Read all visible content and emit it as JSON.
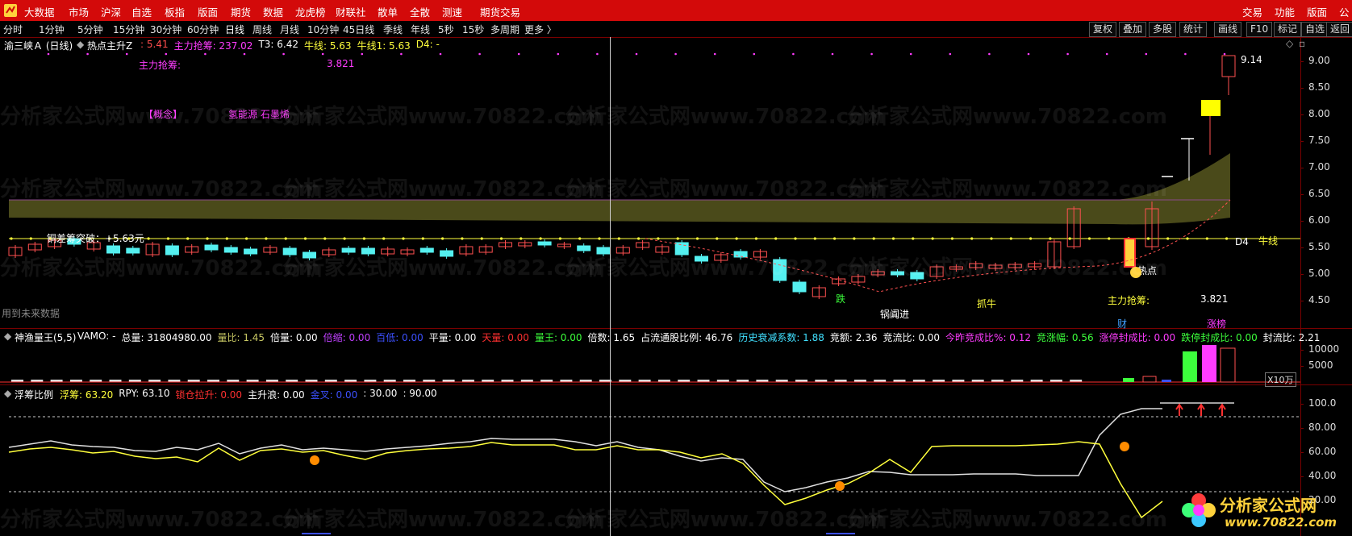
{
  "menubar": {
    "left_items": [
      "大数据",
      "市场",
      "沪深",
      "自选",
      "板指",
      "版面",
      "期货",
      "数据",
      "龙虎榜",
      "财联社",
      "散单",
      "全散",
      "测速",
      "期货交易"
    ],
    "right_items": [
      "交易",
      "功能",
      "版面",
      "公"
    ]
  },
  "periodbar": {
    "periods": [
      "分时",
      "1分钟",
      "5分钟",
      "15分钟",
      "30分钟",
      "60分钟",
      "日线",
      "周线",
      "月线",
      "10分钟",
      "45日线",
      "季线",
      "年线",
      "5秒",
      "15秒",
      "多周期",
      "更多 〉"
    ],
    "right_buttons": [
      "复权",
      "叠加",
      "多股",
      "统计",
      "画线",
      "F10",
      "标记",
      "自选",
      "返回"
    ]
  },
  "main_panel": {
    "stock_title": "渝三峡Ａ (日线)",
    "indicator_name": "热点主升Z",
    "values": [
      {
        "text": ": 5.41",
        "color": "#ff4d4d"
      },
      {
        "text": "主力抢筹: 237.02",
        "color": "#ff3cff"
      },
      {
        "text": "T3: 6.42",
        "color": "#ffffff"
      },
      {
        "text": "牛线: 5.63",
        "color": "#ffff3c"
      },
      {
        "text": "牛线1: 5.63",
        "color": "#ffff3c"
      },
      {
        "text": "D4: -",
        "color": "#ffff3c"
      }
    ],
    "annot_zhuli_label": "主力抢筹:",
    "annot_zhuli_value": "3.821",
    "concept_label": "【概念】",
    "concept_value": "氢能源 石墨烯",
    "breakout_label": "铜差筹突破：+5.63元",
    "future_data": "用到未来数据",
    "label_die": "跌",
    "label_zhua_niu": "抓牛",
    "label_wo_lun": "锅阗进",
    "label_re_dian": "热点",
    "label_niu_xian": "牛线",
    "label_d4": "D4",
    "label_zhuli_bottom": "主力抢筹:",
    "label_zhuli_bottom_val": "3.821",
    "label_cai": "财",
    "label_zhang_bang": "涨榜",
    "high_price_label": "9.14",
    "y_axis": [
      "9.00",
      "8.50",
      "8.00",
      "7.50",
      "7.00",
      "6.50",
      "6.00",
      "5.50",
      "5.00",
      "4.50"
    ]
  },
  "vol_panel": {
    "title": "神渔量王(5,5)",
    "values": [
      {
        "text": "VAMO: -",
        "color": "#ffffff"
      },
      {
        "text": "总量: 31804980.00",
        "color": "#ffffff"
      },
      {
        "text": "量比: 1.45",
        "color": "#c8c864"
      },
      {
        "text": "倍量: 0.00",
        "color": "#ffffff"
      },
      {
        "text": "倍缩: 0.00",
        "color": "#c040ff"
      },
      {
        "text": "百低: 0.00",
        "color": "#3c50ff"
      },
      {
        "text": "平量: 0.00",
        "color": "#ffffff"
      },
      {
        "text": "天量: 0.00",
        "color": "#ff3030"
      },
      {
        "text": "量王: 0.00",
        "color": "#3cff3c"
      },
      {
        "text": "倍数: 1.65",
        "color": "#ffffff"
      },
      {
        "text": "占流通股比例: 46.76",
        "color": "#ffffff"
      },
      {
        "text": "历史衰减系数: 1.88",
        "color": "#40e0ff"
      },
      {
        "text": "竞额: 2.36",
        "color": "#ffffff"
      },
      {
        "text": "竞流比: 0.00",
        "color": "#ffffff"
      },
      {
        "text": "今昨竞成比%: 0.12",
        "color": "#ff3cff"
      },
      {
        "text": "竞涨幅: 0.56",
        "color": "#3cff3c"
      },
      {
        "text": "涨停封成比: 0.00",
        "color": "#ff3cff"
      },
      {
        "text": "跌停封成比: 0.00",
        "color": "#3cff3c"
      },
      {
        "text": "封流比: 2.21",
        "color": "#ffffff"
      }
    ],
    "y_axis": [
      "10000",
      "5000"
    ],
    "unit": "X10万"
  },
  "ratio_panel": {
    "title": "浮筹比例",
    "values": [
      {
        "text": "浮筹: 63.20",
        "color": "#ffff3c"
      },
      {
        "text": "RPY: 63.10",
        "color": "#ffffff"
      },
      {
        "text": "锁仓拉升: 0.00",
        "color": "#ff3030"
      },
      {
        "text": "主升浪: 0.00",
        "color": "#ffffff"
      },
      {
        "text": "金叉: 0.00",
        "color": "#3c50ff"
      },
      {
        "text": ": 30.00",
        "color": "#ffffff"
      },
      {
        "text": ": 90.00",
        "color": "#ffffff"
      }
    ],
    "y_axis": [
      "100.0",
      "80.00",
      "60.00",
      "40.00",
      "20.00"
    ]
  },
  "watermark": {
    "text": "分析家公式网www.70822.com",
    "brand": "分析家公式网",
    "brand_url": "www.70822.com"
  },
  "colors": {
    "menu_red": "#d30a0a",
    "candle_up": "#ff5050",
    "candle_down": "#54f0f0",
    "band": "#4a4a1a",
    "yellow": "#ffff3c",
    "magenta": "#ff3cff"
  }
}
